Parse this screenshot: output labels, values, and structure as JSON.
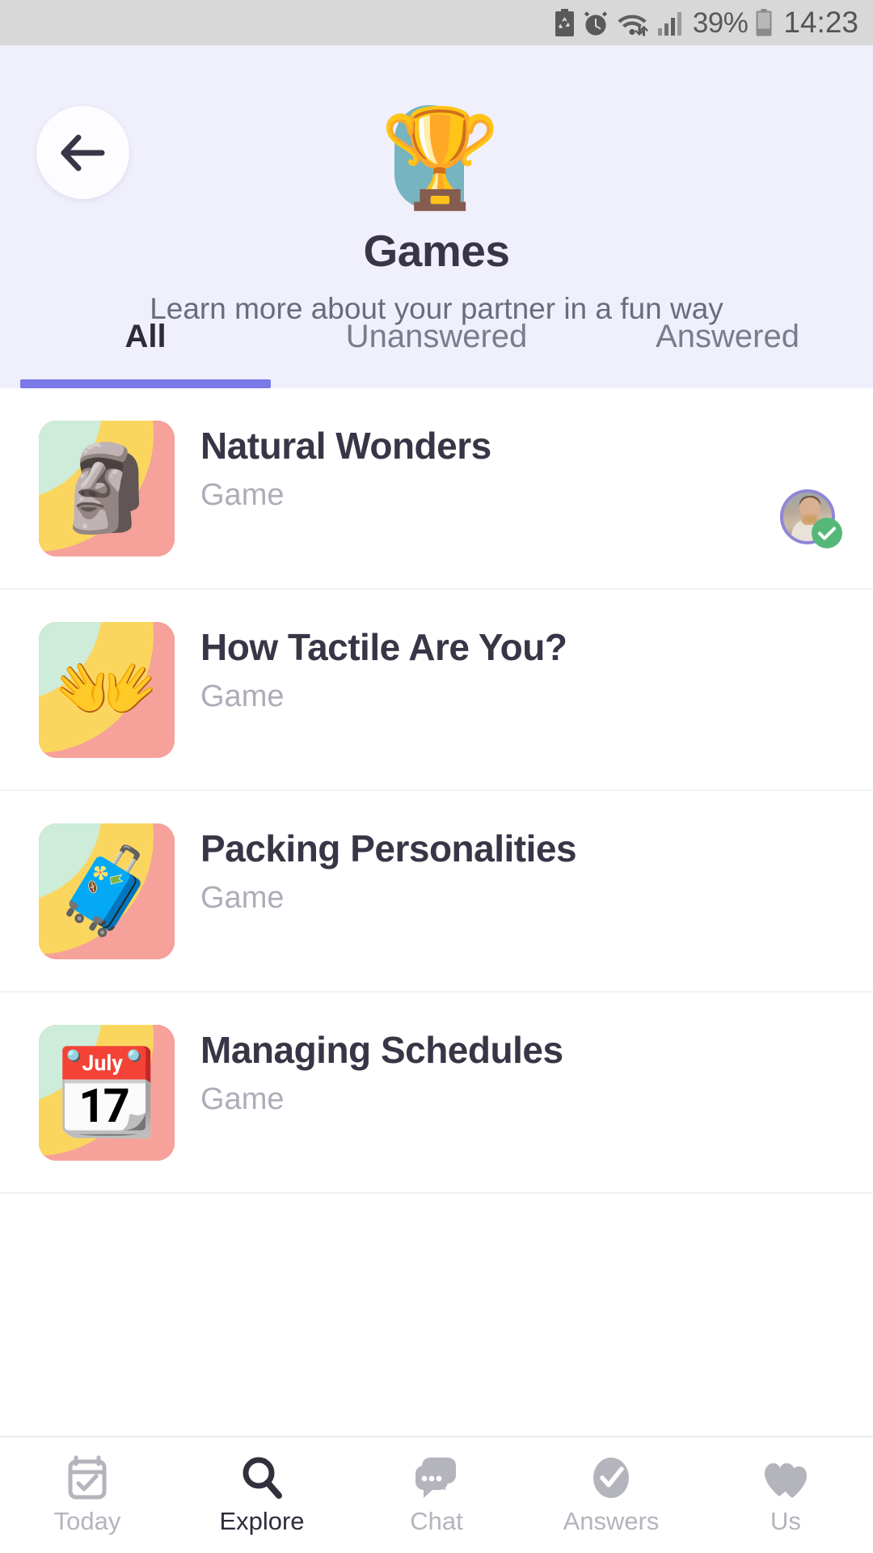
{
  "status_bar": {
    "icons": [
      "battery-saver-icon",
      "alarm-icon",
      "wifi-icon",
      "signal-icon"
    ],
    "battery_percent": "39%",
    "battery_icon": "battery-icon",
    "time": "14:23"
  },
  "header": {
    "background_color": "#f0f0fc",
    "back_icon": "arrow-left-icon",
    "hero_emoji": "🏆",
    "hero_emoji_name": "trophy-emoji",
    "blob_color": "#76b4c0",
    "title": "Games",
    "subtitle": "Learn more about your partner in a fun way"
  },
  "tabs": {
    "accent_color": "#7b79e8",
    "items": [
      {
        "label": "All",
        "active": true
      },
      {
        "label": "Unanswered",
        "active": false
      },
      {
        "label": "Answered",
        "active": false
      }
    ]
  },
  "list": {
    "items": [
      {
        "title": "Natural Wonders",
        "subtitle": "Game",
        "emoji": "🗿",
        "emoji_name": "moai-emoji",
        "has_avatar": true,
        "avatar_ring_color": "#8e86d8",
        "badge_color": "#56b878",
        "badge_icon": "check-icon"
      },
      {
        "title": "How Tactile Are You?",
        "subtitle": "Game",
        "emoji": "👐",
        "emoji_name": "open-hands-emoji",
        "has_avatar": false
      },
      {
        "title": "Packing Personalities",
        "subtitle": "Game",
        "emoji": "🧳",
        "emoji_name": "luggage-emoji",
        "has_avatar": false
      },
      {
        "title": "Managing Schedules",
        "subtitle": "Game",
        "emoji": "📆",
        "emoji_name": "tear-off-calendar-emoji",
        "has_avatar": false
      }
    ]
  },
  "bottom_nav": {
    "items": [
      {
        "label": "Today",
        "icon": "calendar-check-icon",
        "active": false
      },
      {
        "label": "Explore",
        "icon": "search-icon",
        "active": true
      },
      {
        "label": "Chat",
        "icon": "chat-bubbles-icon",
        "active": false
      },
      {
        "label": "Answers",
        "icon": "check-circle-icon",
        "active": false
      },
      {
        "label": "Us",
        "icon": "two-hearts-icon",
        "active": false
      }
    ]
  }
}
